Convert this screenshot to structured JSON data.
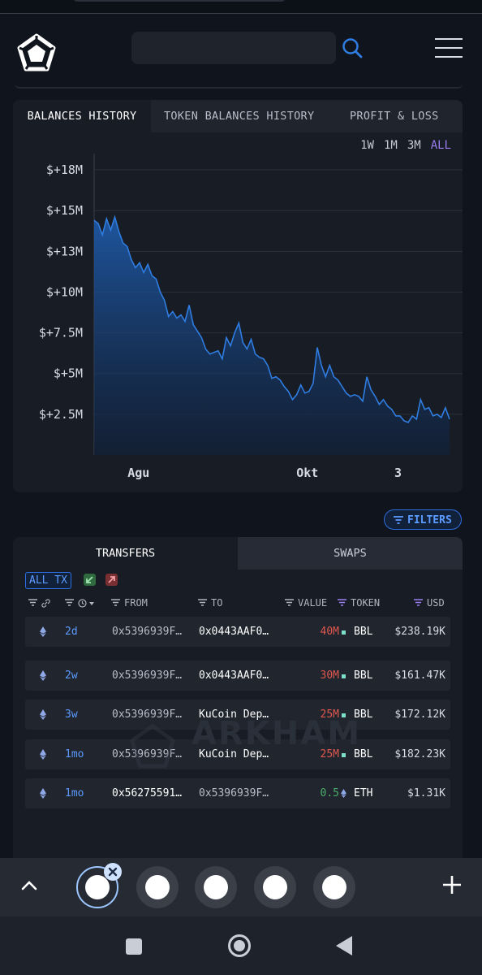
{
  "chart_tabs": [
    "BALANCES HISTORY",
    "TOKEN BALANCES HISTORY",
    "PROFIT & LOSS"
  ],
  "ranges": [
    "1W",
    "1M",
    "3M",
    "ALL"
  ],
  "selected_range": "ALL",
  "chart_data": {
    "type": "area",
    "yticks": [
      "$+18M",
      "$+15M",
      "$+13M",
      "$+10M",
      "$+7.5M",
      "$+5M",
      "$+2.5M"
    ],
    "ytick_values": [
      17.5,
      15,
      12.5,
      10,
      7.5,
      5,
      2.5
    ],
    "xticks": [
      "Agu",
      "Okt",
      "3"
    ],
    "xtick_positions": [
      0.125,
      0.6,
      0.855
    ],
    "ylim": [
      0,
      18.5
    ],
    "series": [
      {
        "values": [
          14.4,
          14.2,
          13.5,
          14.5,
          13.8,
          14.6,
          13.7,
          13.0,
          12.8,
          12.0,
          11.5,
          11.8,
          11.2,
          11.7,
          11.0,
          10.8,
          10.0,
          9.5,
          8.5,
          8.8,
          8.4,
          8.6,
          8.2,
          9.2,
          8.0,
          7.6,
          7.2,
          6.5,
          6.2,
          6.3,
          6.4,
          5.9,
          7.2,
          6.7,
          7.5,
          8.1,
          6.9,
          6.5,
          7.1,
          6.2,
          6.0,
          5.9,
          5.5,
          4.7,
          4.8,
          4.6,
          4.2,
          3.9,
          3.4,
          3.7,
          4.3,
          3.8,
          3.9,
          4.4,
          6.6,
          5.5,
          4.8,
          5.5,
          4.8,
          4.6,
          4.2,
          3.8,
          3.6,
          3.7,
          3.6,
          3.3,
          4.8,
          4.0,
          3.6,
          3.1,
          3.4,
          3.0,
          2.8,
          2.4,
          2.4,
          2.1,
          2.0,
          2.4,
          2.2,
          3.4,
          2.8,
          2.9,
          2.4,
          2.5,
          2.3,
          2.9,
          2.2
        ]
      }
    ]
  },
  "filters_label": "FILTERS",
  "tx_tabs": [
    "TRANSFERS",
    "SWAPS"
  ],
  "all_tx_label": "ALL TX",
  "columns": [
    "FROM",
    "TO",
    "VALUE",
    "TOKEN",
    "USD"
  ],
  "rows": [
    {
      "time": "2d",
      "from": "0x5396939F…",
      "to": "0x0443AAF0…",
      "value": "40M",
      "token": "BBL",
      "usd": "$238.19K"
    },
    {
      "time": "2w",
      "from": "0x5396939F…",
      "to": "0x0443AAF0…",
      "value": "30M",
      "token": "BBL",
      "usd": "$161.47K"
    },
    {
      "time": "3w",
      "from": "0x5396939F…",
      "to": "KuCoin Dep…",
      "value": "25M",
      "token": "BBL",
      "usd": "$172.12K"
    },
    {
      "time": "1mo",
      "from": "0x5396939F…",
      "to": "KuCoin Dep…",
      "value": "25M",
      "token": "BBL",
      "usd": "$182.23K"
    },
    {
      "time": "1mo",
      "from": "0x56275591…",
      "to": "0x5396939F…",
      "value": "0.5",
      "token": "ETH",
      "usd": "$1.31K"
    }
  ],
  "watermark": "ARKHAM",
  "colors": {
    "accent": "#5c9bff",
    "selected_range": "#9b7ff0",
    "out_value": "#e0574f",
    "in_value": "#4caf6a",
    "line": "#2f7de1"
  }
}
